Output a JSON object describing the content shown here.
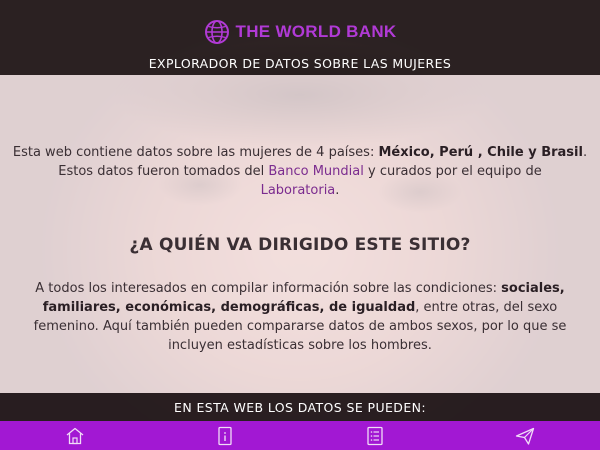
{
  "header": {
    "brand_name": "THE WORLD BANK",
    "subtitle": "EXPLORADOR DE DATOS SOBRE LAS MUJERES"
  },
  "intro": {
    "text_1": "Esta web contiene datos sobre las mujeres de 4 países: ",
    "countries": "México, Perú , Chile y Brasil",
    "text_2": ".",
    "text_3": "Estos datos fueron tomados del ",
    "link_bank": "Banco Mundial",
    "text_4": " y curados por el equipo de",
    "link_lab": "Laboratoria",
    "text_5": "."
  },
  "question": {
    "title": "¿A QUIÉN VA DIRIGIDO ESTE SITIO?"
  },
  "audience": {
    "text_1": "A todos los interesados en compilar información sobre las condiciones: ",
    "categories": "sociales, familiares, económicas, demográficas, de igualdad",
    "text_2": ", entre otras, del sexo femenino. Aquí también pueden compararse datos de ambos sexos, por lo que se incluyen estadísticas sobre los hombres."
  },
  "bottom_banner": {
    "text": "EN ESTA WEB LOS DATOS SE PUEDEN:"
  },
  "nav": {
    "items": [
      "home-icon",
      "info-icon",
      "list-icon",
      "send-icon"
    ]
  },
  "colors": {
    "brand": "#b13ad6",
    "nav_bar": "#a218d3",
    "link": "#7b2c8f"
  }
}
